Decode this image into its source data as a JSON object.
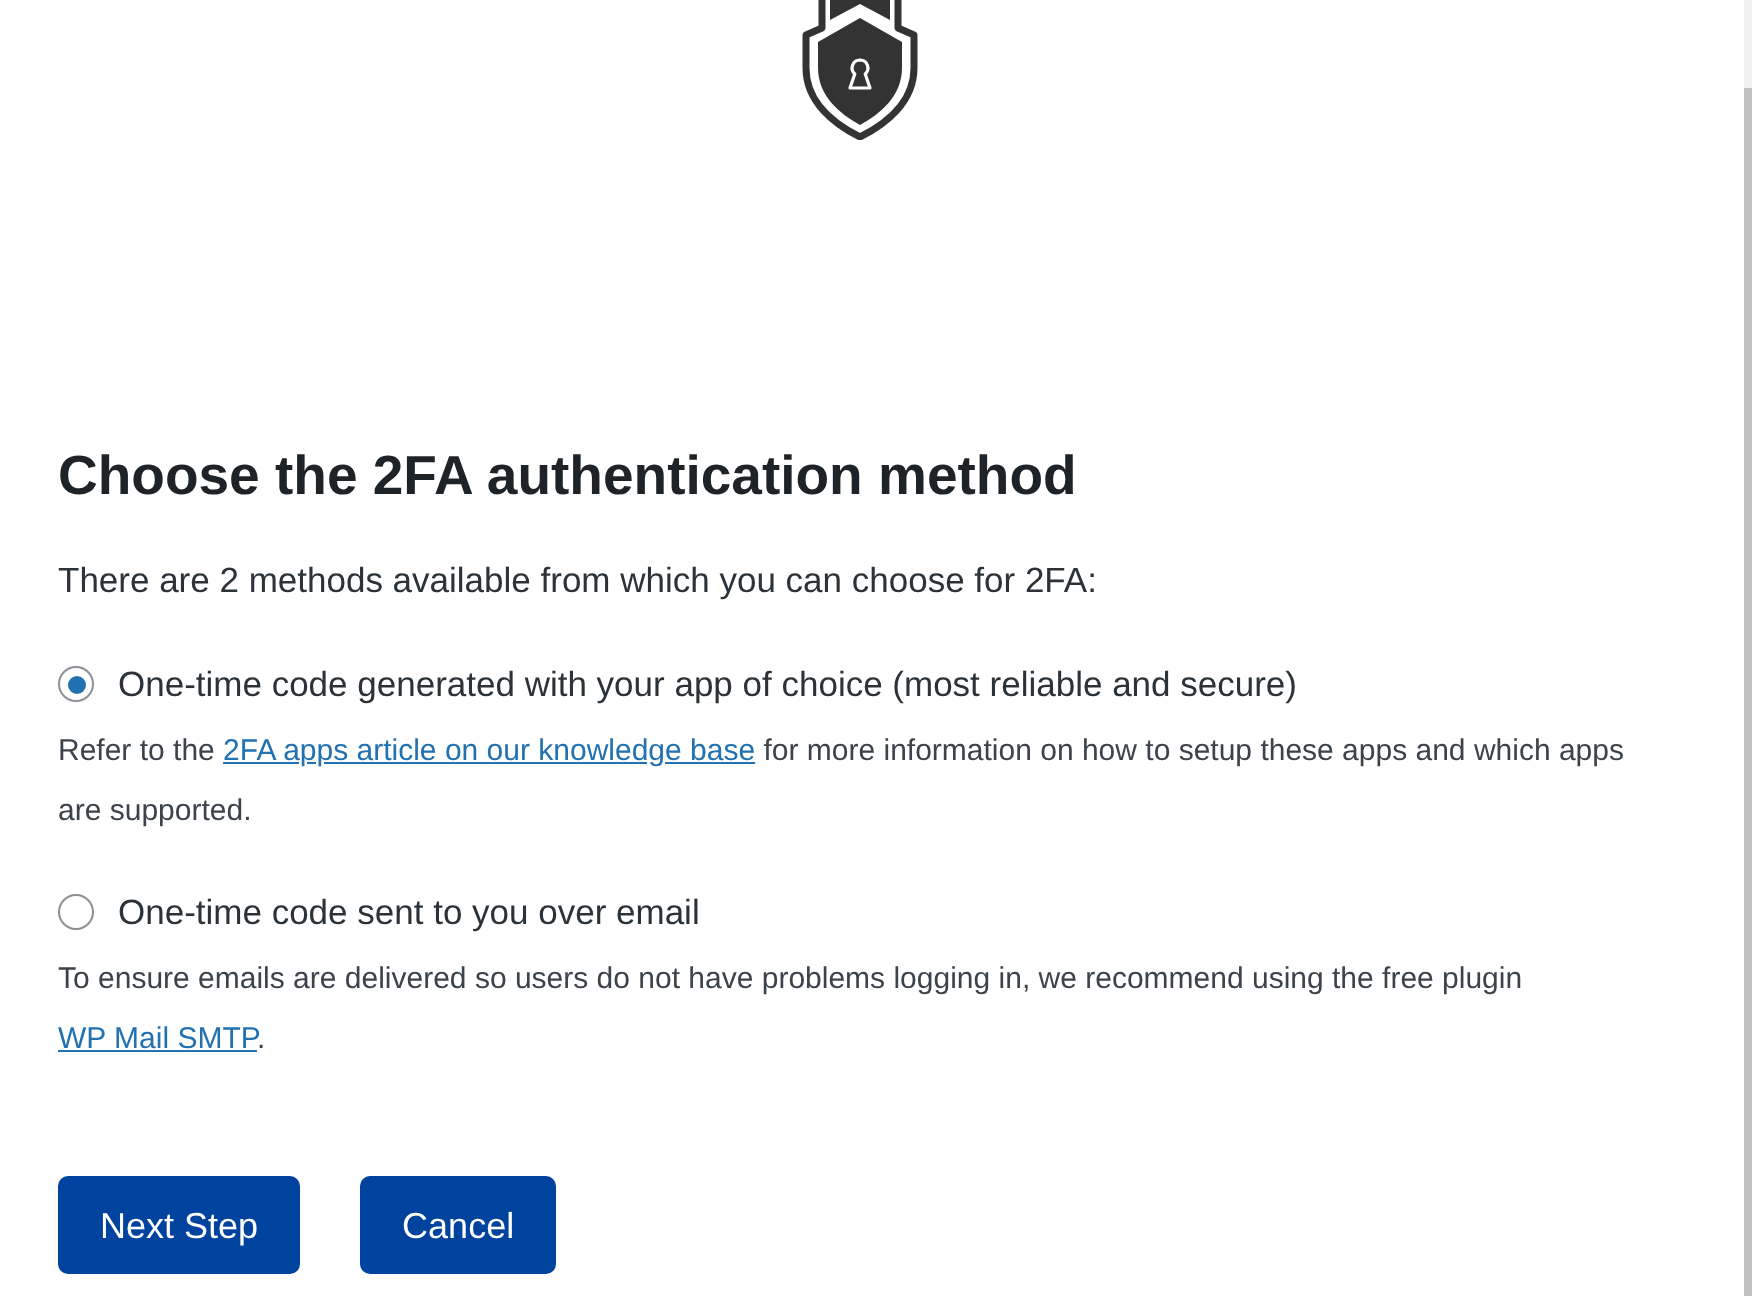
{
  "heading": "Choose the 2FA authentication method",
  "intro": "There are 2 methods available from which you can choose for 2FA:",
  "methods": [
    {
      "label": "One-time code generated with your app of choice (most reliable and secure)",
      "selected": true,
      "description": {
        "before": "Refer to the ",
        "link": "2FA apps article on our knowledge base",
        "after": " for more information on how to setup these apps and which apps are supported."
      }
    },
    {
      "label": "One-time code sent to you over email",
      "selected": false,
      "description": {
        "before": "To ensure emails are delivered so users do not have problems logging in, we recommend using the free plugin ",
        "link": "WP Mail SMTP",
        "after": "."
      }
    }
  ],
  "buttons": [
    "Next Step",
    "Cancel"
  ]
}
